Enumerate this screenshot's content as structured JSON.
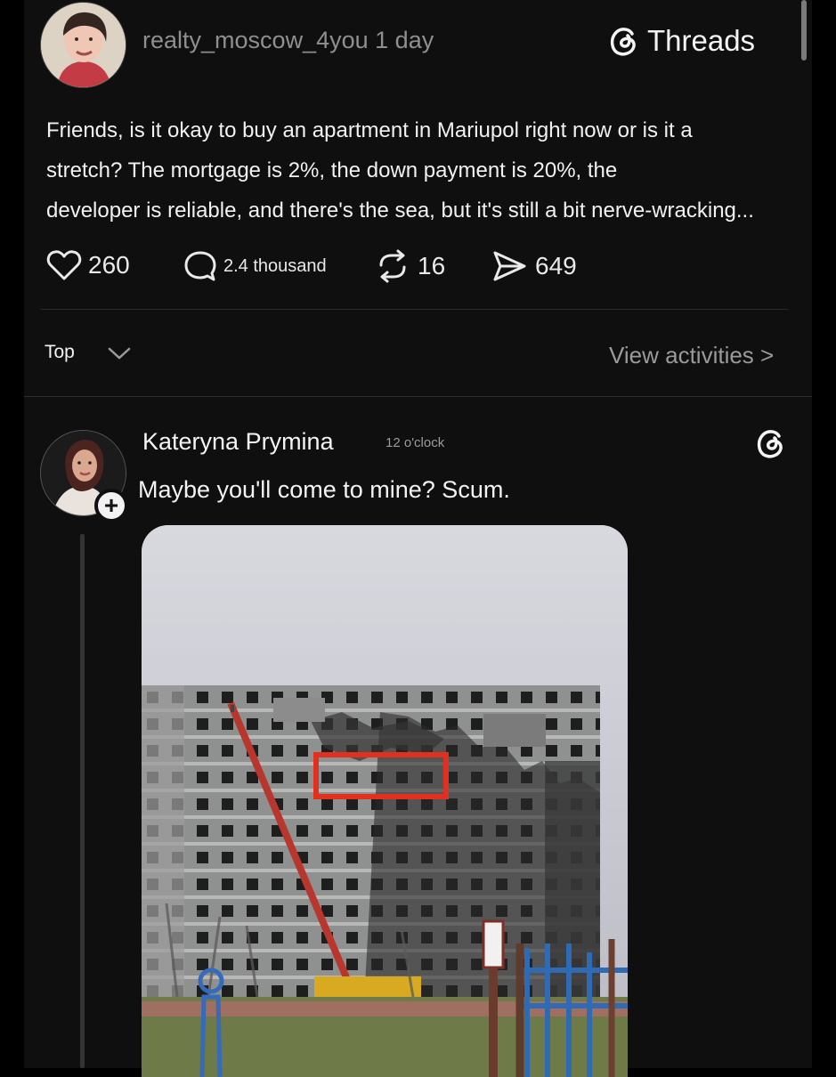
{
  "post": {
    "author": "realty_moscow_4you",
    "time": "1 day",
    "brand": "Threads",
    "text": "Friends, is it okay to buy an apartment in Mariupol right now or is it a\nstretch? The mortgage is 2%, the down payment is 20%, the\ndeveloper is reliable, and there's the sea, but it's still a bit nerve-wracking...",
    "stats": {
      "likes": "260",
      "comments": "2.4 thousand",
      "reposts": "16",
      "shares": "649"
    }
  },
  "sort": {
    "label": "Top",
    "activities_link": "View activities >"
  },
  "reply": {
    "author": "Kateryna Prymina",
    "time": "12 o'clock",
    "text": "Maybe you'll come to mine? Scum.",
    "add_button": "+"
  },
  "icons": {
    "avatar": "avatar-icon",
    "threads_logo": "threads-logo-icon",
    "like": "heart-icon",
    "comment": "comment-bubble-icon",
    "repost": "repost-icon",
    "share": "send-icon",
    "chevron": "chevron-down-icon"
  },
  "colors": {
    "background": "#0f0f10",
    "text_primary": "#f3f3f3",
    "text_secondary": "#8f8f8f",
    "highlight_red": "#e1301f"
  }
}
